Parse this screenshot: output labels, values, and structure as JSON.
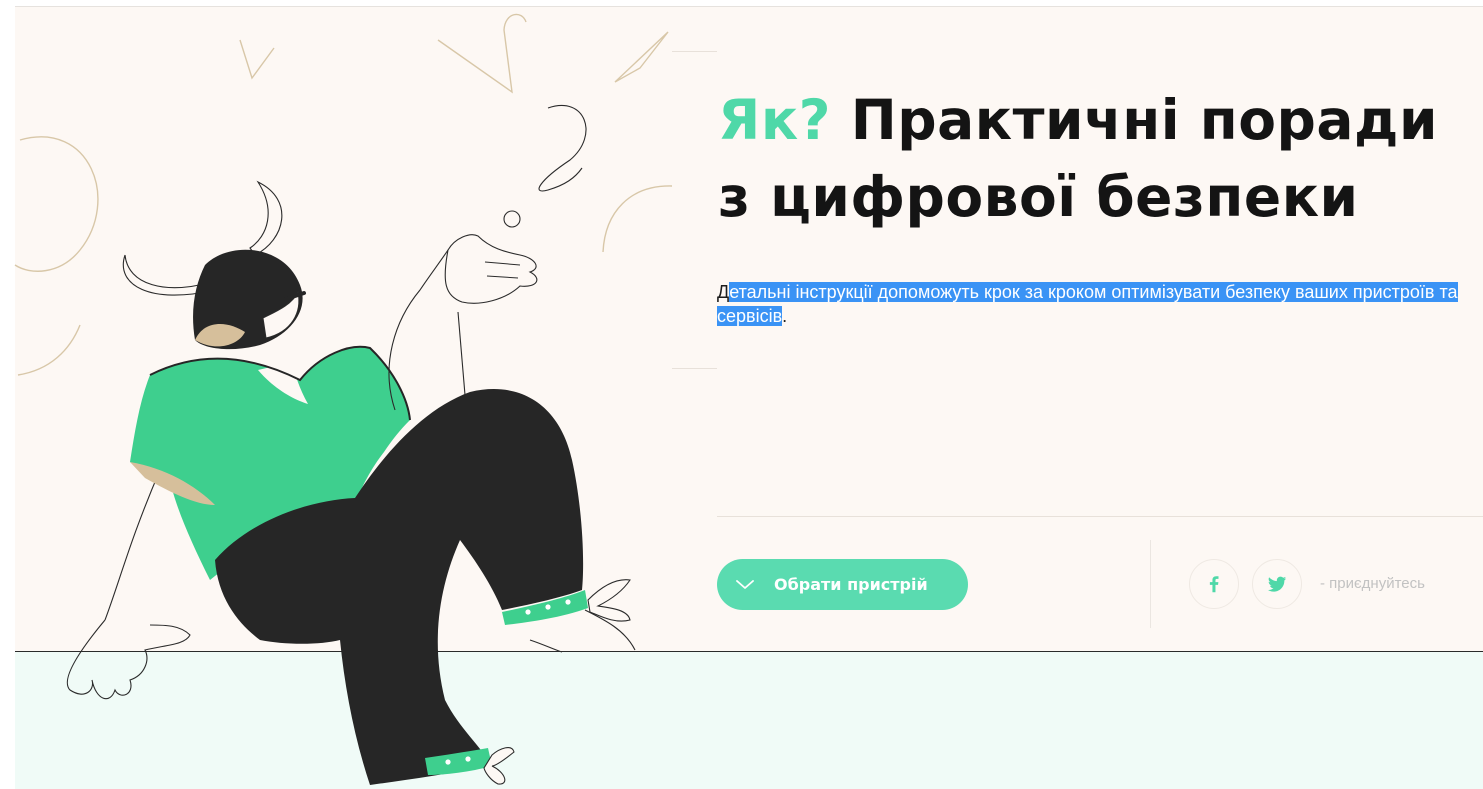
{
  "hero": {
    "title_accent": "Як?",
    "title_rest": "Практичні поради з цифрової безпеки",
    "lead_first_char": "Д",
    "lead_selected": "етальні інструкції допоможуть крок за кроком оптимізувати безпеку ваших пристроїв та сервісів",
    "lead_end": "."
  },
  "cta": {
    "label": "Обрати пристрій",
    "icon": "chevron-down-icon"
  },
  "social": {
    "facebook_icon": "facebook-icon",
    "twitter_icon": "twitter-icon",
    "join_text": "- приєднуйтесь"
  },
  "colors": {
    "accent": "#4fd8a8",
    "button": "#5adbb0",
    "selection": "#3a93f5",
    "hero_bg": "#fdf8f4",
    "footer_bg": "#f0fbf7",
    "shirt": "#3ecf8e",
    "dark": "#262626",
    "skin": "#d6bf9b"
  }
}
